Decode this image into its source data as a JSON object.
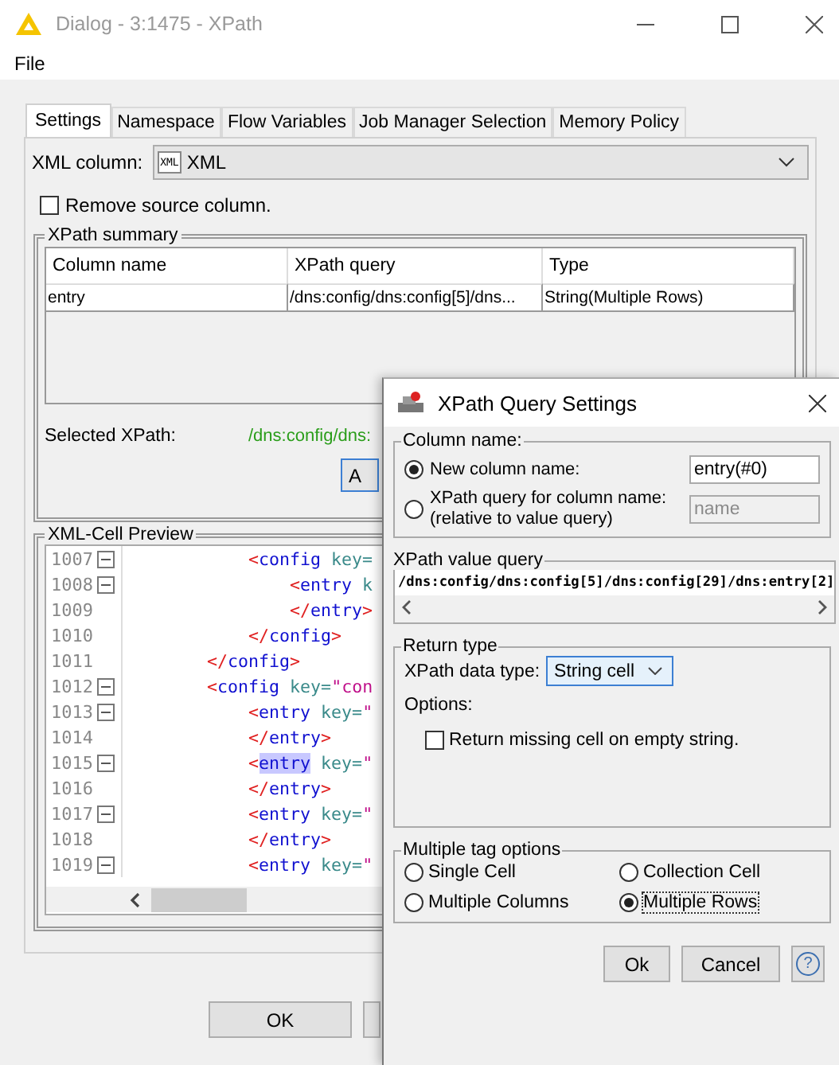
{
  "window": {
    "title": "Dialog - 3:1475 - XPath"
  },
  "menu": [
    "File"
  ],
  "tabs": [
    {
      "label": "Settings",
      "selected": true
    },
    {
      "label": "Namespace",
      "selected": false
    },
    {
      "label": "Flow Variables",
      "selected": false
    },
    {
      "label": "Job Manager Selection",
      "selected": false
    },
    {
      "label": "Memory Policy",
      "selected": false
    }
  ],
  "xml_column": {
    "label": "XML column:",
    "type_badge": "XML",
    "value": "XML"
  },
  "remove_source": {
    "label": "Remove source column.",
    "checked": false
  },
  "summary": {
    "title": "XPath summary",
    "columns": [
      "Column name",
      "XPath query",
      "Type"
    ],
    "rows": [
      [
        "entry",
        "/dns:config/dns:config[5]/dns...",
        "String(Multiple Rows)"
      ]
    ],
    "selected_label": "Selected XPath:",
    "selected_value": "/dns:config/dns:",
    "button": "A"
  },
  "preview": {
    "title": "XML-Cell Preview",
    "lines": [
      {
        "number": "1007",
        "fold": true,
        "highlight": false,
        "text": "            <config key="
      },
      {
        "number": "1008",
        "fold": true,
        "highlight": false,
        "text": "                <entry k"
      },
      {
        "number": "1009",
        "fold": false,
        "highlight": false,
        "text": "                </entry>"
      },
      {
        "number": "1010",
        "fold": false,
        "highlight": false,
        "text": "            </config>"
      },
      {
        "number": "1011",
        "fold": false,
        "highlight": false,
        "text": "        </config>"
      },
      {
        "number": "1012",
        "fold": true,
        "highlight": false,
        "text": "        <config key=\"con"
      },
      {
        "number": "1013",
        "fold": true,
        "highlight": false,
        "text": "            <entry key=\""
      },
      {
        "number": "1014",
        "fold": false,
        "highlight": false,
        "text": "            </entry>"
      },
      {
        "number": "1015",
        "fold": true,
        "highlight": true,
        "text": "            <entry key=\""
      },
      {
        "number": "1016",
        "fold": false,
        "highlight": false,
        "text": "            </entry>"
      },
      {
        "number": "1017",
        "fold": true,
        "highlight": false,
        "text": "            <entry key=\""
      },
      {
        "number": "1018",
        "fold": false,
        "highlight": false,
        "text": "            </entry>"
      },
      {
        "number": "1019",
        "fold": true,
        "highlight": false,
        "text": "            <entry key=\""
      }
    ]
  },
  "buttons": [
    "OK"
  ],
  "query_dialog": {
    "title": "XPath Query Settings",
    "column_name": {
      "title": "Column name:",
      "options": [
        {
          "label": "New column name:",
          "selected": true,
          "field": "entry(#0)",
          "disabled": false
        },
        {
          "label": "XPath query for column name:",
          "sublabel": "(relative to value query)",
          "selected": false,
          "field": "name",
          "disabled": true
        }
      ]
    },
    "value_query": {
      "title": "XPath value query",
      "value": "/dns:config/dns:config[5]/dns:config[29]/dns:entry[2]"
    },
    "return_type": {
      "title": "Return type",
      "type_label": "XPath data type:",
      "type_value": "String cell",
      "options_label": "Options:",
      "missing": {
        "label": "Return missing cell on empty string.",
        "checked": false
      }
    },
    "multiple": {
      "title": "Multiple tag options",
      "options": [
        {
          "label": "Single Cell",
          "selected": false
        },
        {
          "label": "Collection Cell",
          "selected": false
        },
        {
          "label": "Multiple Columns",
          "selected": false
        },
        {
          "label": "Multiple Rows",
          "selected": true
        }
      ]
    },
    "buttons": [
      "Ok",
      "Cancel"
    ],
    "help": "?"
  }
}
